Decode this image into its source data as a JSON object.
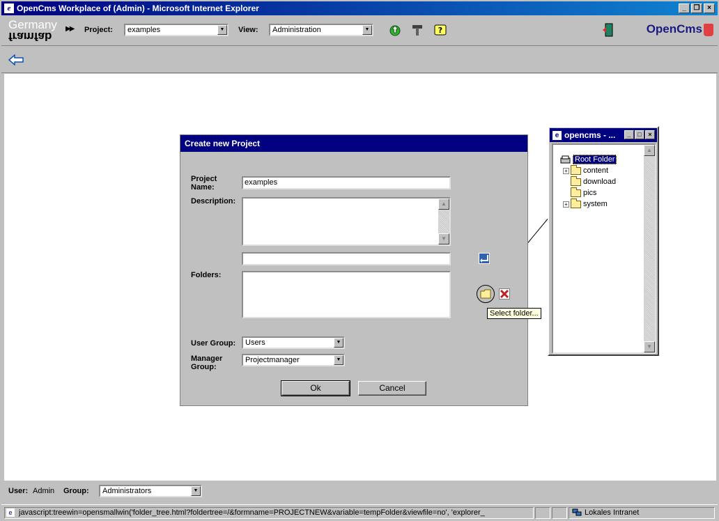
{
  "window": {
    "title": "OpenCms Workplace of (Admin) - Microsoft Internet Explorer"
  },
  "toolbar": {
    "logo_top": "Germany",
    "logo_bottom": "framfab",
    "project_label": "Project:",
    "project_value": "examples",
    "view_label": "View:",
    "view_value": "Administration",
    "brand": "OpenCms"
  },
  "dialog": {
    "title": "Create new Project",
    "project_name_label": "Project\nName:",
    "project_name_value": "examples",
    "description_label": "Description:",
    "description_value": "",
    "folder_input_value": "",
    "folders_label": "Folders:",
    "user_group_label": "User Group:",
    "user_group_value": "Users",
    "manager_group_label": "Manager\nGroup:",
    "manager_group_value": "Projectmanager",
    "ok_label": "Ok",
    "cancel_label": "Cancel",
    "tooltip": "Select folder..."
  },
  "popup": {
    "title": "opencms - ...",
    "root": "Root Folder",
    "items": [
      {
        "label": "content",
        "expandable": true
      },
      {
        "label": "download",
        "expandable": false
      },
      {
        "label": "pics",
        "expandable": false
      },
      {
        "label": "system",
        "expandable": true
      }
    ]
  },
  "footer": {
    "user_label": "User:",
    "user_value": "Admin",
    "group_label": "Group:",
    "group_value": "Administrators"
  },
  "statusbar": {
    "text": "javascript:treewin=opensmallwin('folder_tree.html?foldertree=/&formname=PROJECTNEW&variable=tempFolder&viewfile=no', 'explorer_",
    "zone": "Lokales Intranet"
  }
}
